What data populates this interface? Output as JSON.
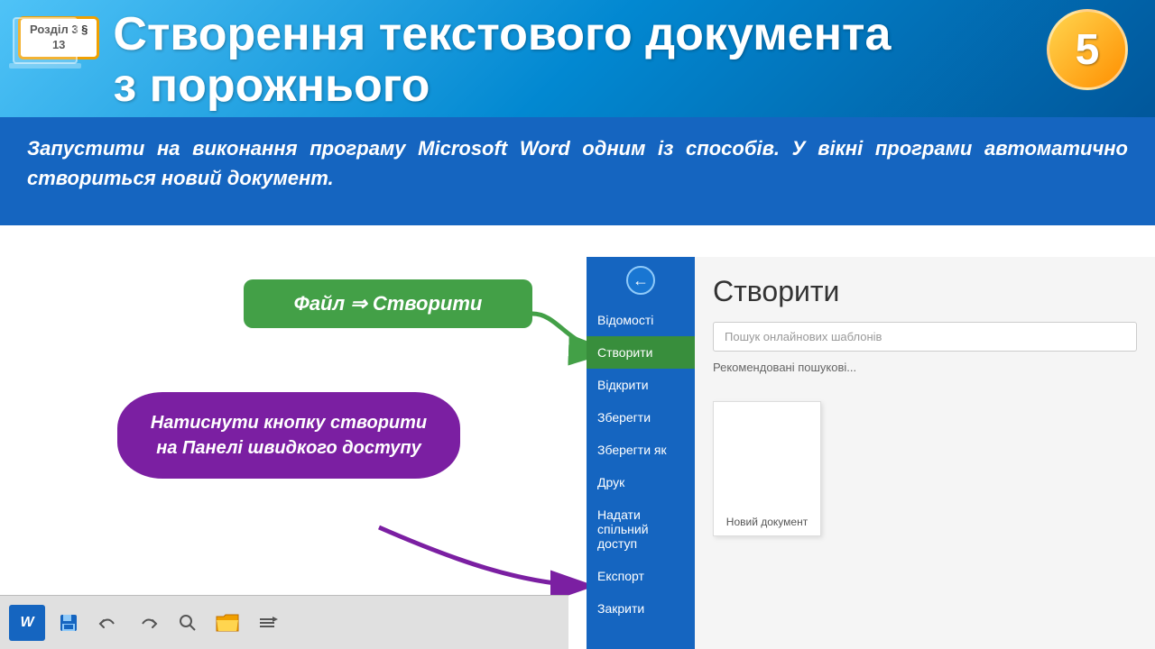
{
  "header": {
    "badge_line1": "Розділ 3 §",
    "badge_line2": "13",
    "title_line1": "Створення текстового документа",
    "title_line2": "з порожнього",
    "number": "5"
  },
  "instruction": {
    "text": "Запустити на виконання програму Microsoft Word одним із способів. У вікні програми автоматично створиться новий документ."
  },
  "callout_green": {
    "text": "Файл ⇒ Створити"
  },
  "callout_purple": {
    "text": "Натиснути кнопку створити на Панелі швидкого доступу"
  },
  "sidebar": {
    "items": [
      {
        "label": "Відомості",
        "active": false
      },
      {
        "label": "Створити",
        "active": true
      },
      {
        "label": "Відкрити",
        "active": false
      },
      {
        "label": "Зберегти",
        "active": false
      },
      {
        "label": "Зберегти як",
        "active": false
      },
      {
        "label": "Друк",
        "active": false
      },
      {
        "label": "Надати спільний доступ",
        "active": false
      },
      {
        "label": "Експорт",
        "active": false
      },
      {
        "label": "Закрити",
        "active": false
      }
    ]
  },
  "word_panel": {
    "title": "Створити",
    "search_placeholder": "Пошук онлайнових шаблонів",
    "recommended_label": "Рекомендовані пошукові...",
    "new_doc_label": "Новий документ"
  },
  "toolbar": {
    "icons": [
      "W",
      "💾",
      "↩",
      "↪",
      "🔍",
      "📁",
      "≡"
    ]
  }
}
